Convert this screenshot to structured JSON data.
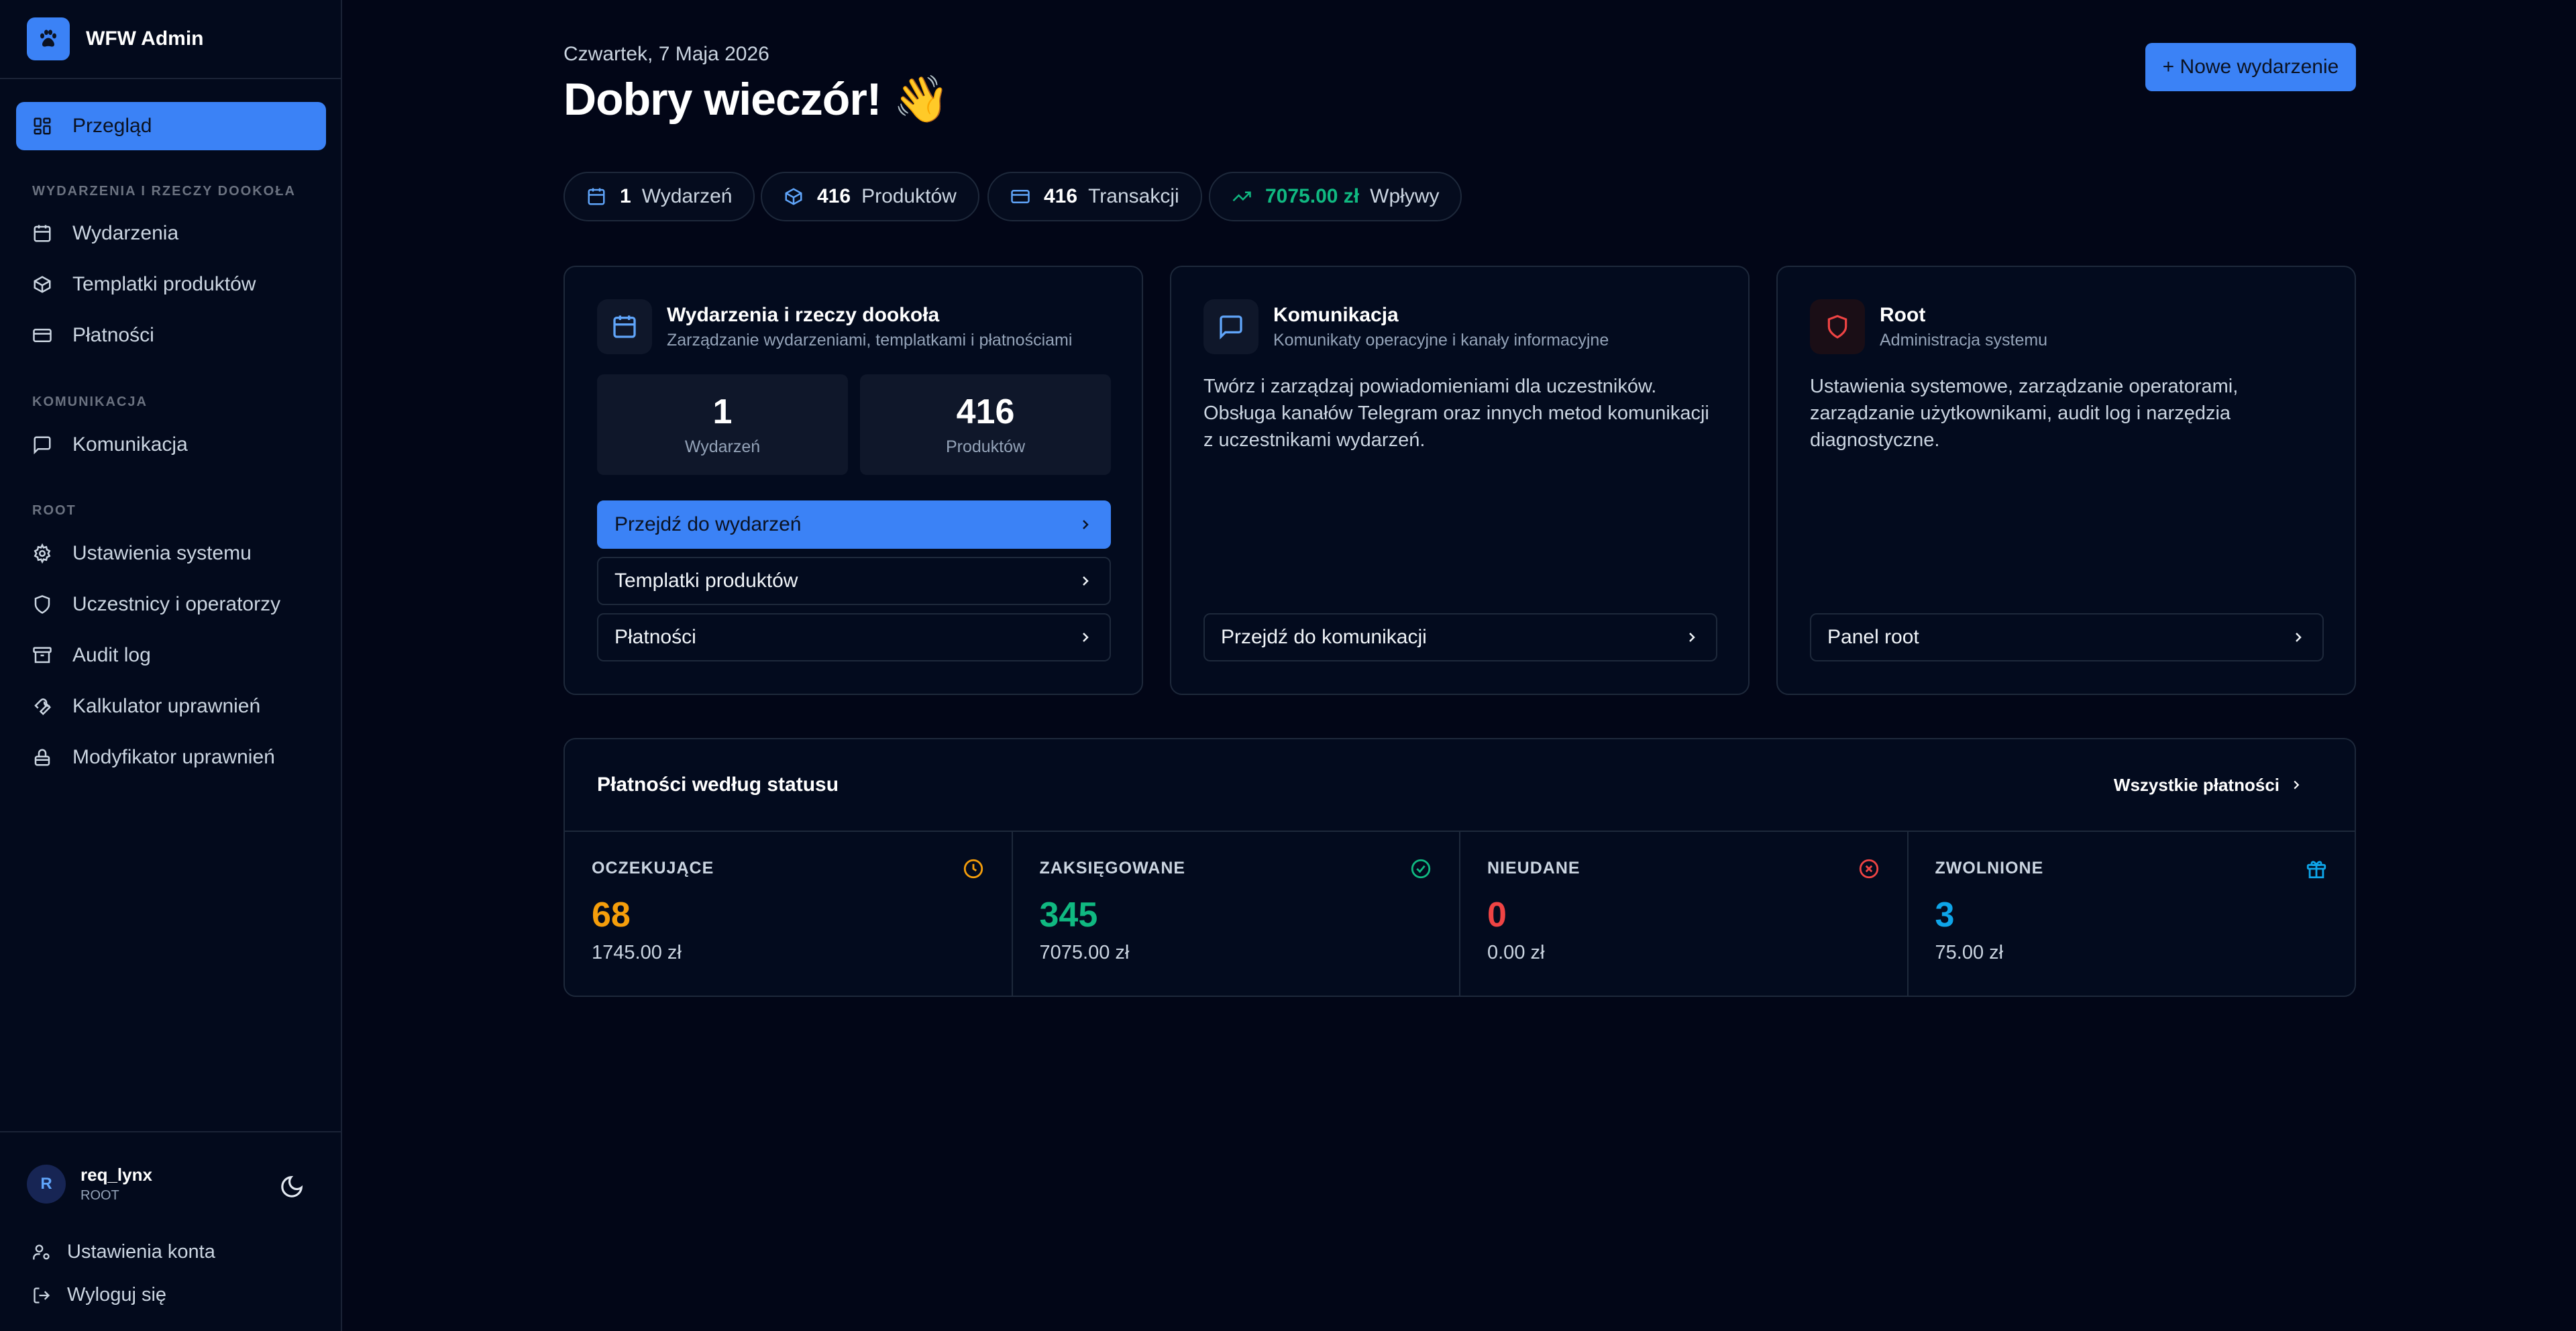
{
  "app": {
    "name": "WFW Admin"
  },
  "sidebar": {
    "active": {
      "label": "Przegląd"
    },
    "sections": [
      {
        "title": "WYDARZENIA I RZECZY DOOKOŁA",
        "items": [
          "Wydarzenia",
          "Templatki produktów",
          "Płatności"
        ]
      },
      {
        "title": "KOMUNIKACJA",
        "items": [
          "Komunikacja"
        ]
      },
      {
        "title": "ROOT",
        "items": [
          "Ustawienia systemu",
          "Uczestnicy i operatorzy",
          "Audit log",
          "Kalkulator uprawnień",
          "Modyfikator uprawnień"
        ]
      }
    ],
    "user": {
      "initial": "R",
      "name": "req_lynx",
      "role": "ROOT"
    },
    "links": {
      "account": "Ustawienia konta",
      "logout": "Wyloguj się"
    }
  },
  "header": {
    "date": "Czwartek, 7 Maja 2026",
    "greeting": "Dobry wieczór! 👋",
    "new_button": "+ Nowe wydarzenie"
  },
  "stats": [
    {
      "num": "1",
      "label": "Wydarzeń",
      "icon": "calendar-icon"
    },
    {
      "num": "416",
      "label": "Produktów",
      "icon": "package-icon"
    },
    {
      "num": "416",
      "label": "Transakcji",
      "icon": "credit-card-icon"
    },
    {
      "num": "7075.00 zł",
      "label": "Wpływy",
      "icon": "trending-up-icon",
      "color": "#10b981"
    }
  ],
  "cards": {
    "events": {
      "title": "Wydarzenia i rzeczy dookoła",
      "subtitle": "Zarządzanie wydarzeniami, templatkami i płatnościami",
      "mini": [
        {
          "num": "1",
          "label": "Wydarzeń"
        },
        {
          "num": "416",
          "label": "Produktów"
        }
      ],
      "buttons": [
        "Przejdź do wydarzeń",
        "Templatki produktów",
        "Płatności"
      ]
    },
    "comms": {
      "title": "Komunikacja",
      "subtitle": "Komunikaty operacyjne i kanały informacyjne",
      "description": "Twórz i zarządzaj powiadomieniami dla uczestników. Obsługa kanałów Telegram oraz innych metod komunikacji z uczestnikami wydarzeń.",
      "button": "Przejdź do komunikacji"
    },
    "root": {
      "title": "Root",
      "subtitle": "Administracja systemu",
      "description": "Ustawienia systemowe, zarządzanie operatorami, zarządzanie użytkownikami, audit log i narzędzia diagnostyczne.",
      "button": "Panel root"
    }
  },
  "payments": {
    "title": "Płatności według statusu",
    "all_link": "Wszystkie płatności",
    "statuses": [
      {
        "label": "OCZEKUJĄCE",
        "count": "68",
        "amount": "1745.00 zł",
        "color": "#f59e0b",
        "icon": "clock-icon"
      },
      {
        "label": "ZAKSIĘGOWANE",
        "count": "345",
        "amount": "7075.00 zł",
        "color": "#10b981",
        "icon": "check-circle-icon"
      },
      {
        "label": "NIEUDANE",
        "count": "0",
        "amount": "0.00 zł",
        "color": "#ef4444",
        "icon": "x-circle-icon"
      },
      {
        "label": "ZWOLNIONE",
        "count": "3",
        "amount": "75.00 zł",
        "color": "#0ea5e9",
        "icon": "gift-icon"
      }
    ]
  }
}
